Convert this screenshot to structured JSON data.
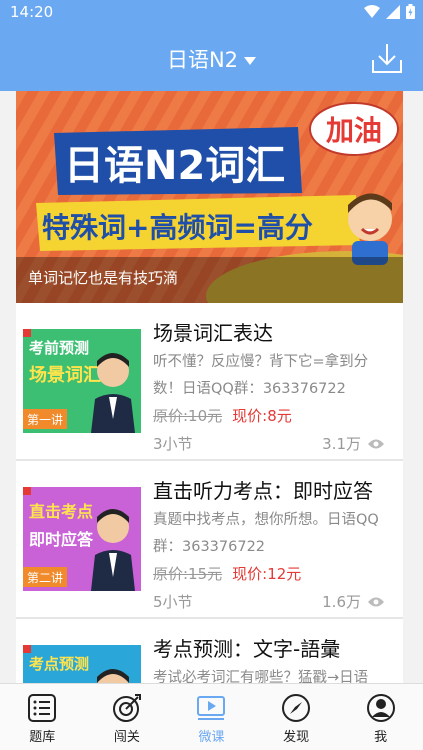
{
  "status": {
    "time": "14:20"
  },
  "appbar": {
    "title": "日语N2"
  },
  "banner": {
    "line1": "日语N2词汇",
    "line2": "特殊词+高频词=高分",
    "badge": "加油",
    "caption": "单词记忆也是有技巧滴"
  },
  "courses": [
    {
      "title": "场景词汇表达",
      "desc": "听不懂？反应慢？背下它=拿到分数！日语QQ群：363376722",
      "old_price": "原价:10元",
      "new_price": "现价:8元",
      "lessons": "3小节",
      "views": "3.1万",
      "thumb_top": "考前预测",
      "thumb_mid": "场景词汇",
      "thumb_tag": "第一讲"
    },
    {
      "title": "直击听力考点：即时应答",
      "desc": "真题中找考点，想你所想。日语QQ群：363376722",
      "old_price": "原价:15元",
      "new_price": "现价:12元",
      "lessons": "5小节",
      "views": "1.6万",
      "thumb_top": "直击考点",
      "thumb_mid": "即时应答",
      "thumb_tag": "第二讲"
    },
    {
      "title": "考点预测：文字-語彙",
      "desc": "考试必考词汇有哪些？猛戳→日语",
      "thumb_top": "考点预测"
    }
  ],
  "nav": [
    {
      "label": "题库"
    },
    {
      "label": "闯关"
    },
    {
      "label": "微课"
    },
    {
      "label": "发现"
    },
    {
      "label": "我"
    }
  ],
  "colors": {
    "primary": "#6aa9f2",
    "price": "#e53935"
  }
}
